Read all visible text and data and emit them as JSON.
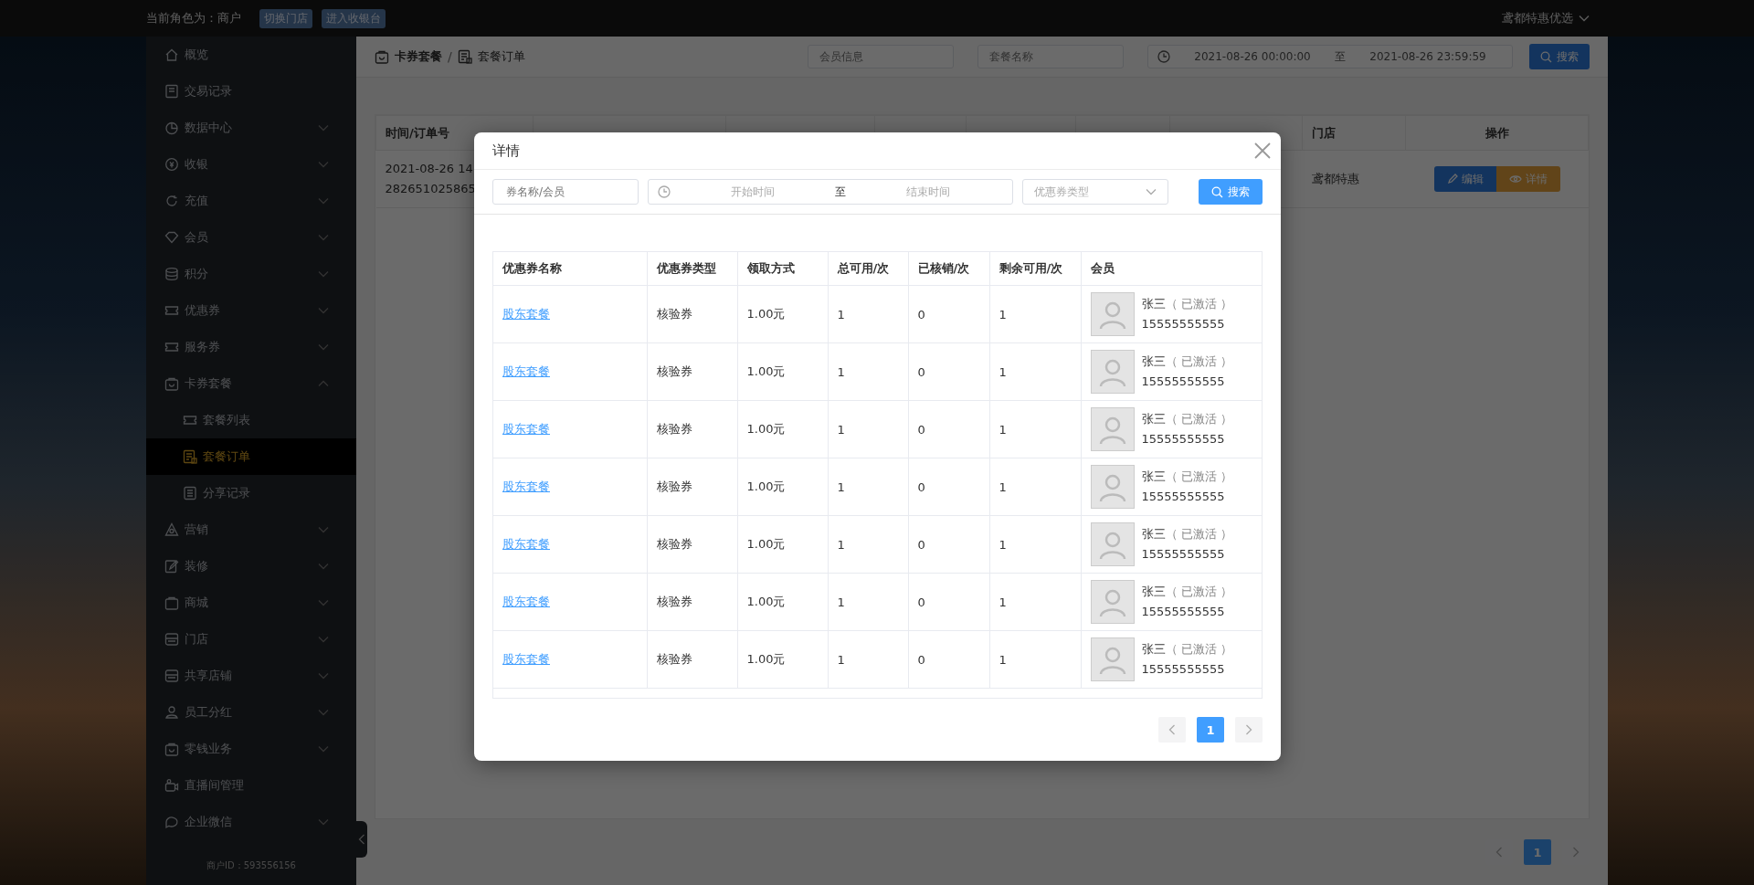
{
  "topbar": {
    "role_label": "当前角色为：商户",
    "buttons": [
      "切换门店",
      "进入收银台"
    ],
    "store_name": "鸢都特惠优选"
  },
  "sidebar": {
    "items": [
      {
        "label": "概览",
        "kind": "link",
        "selected": false
      },
      {
        "label": "交易记录",
        "kind": "link",
        "selected": false
      },
      {
        "label": "数据中心",
        "kind": "group",
        "expanded": false,
        "selected": false
      },
      {
        "label": "收银",
        "kind": "group",
        "expanded": false,
        "selected": false
      },
      {
        "label": "充值",
        "kind": "group",
        "expanded": false,
        "selected": false
      },
      {
        "label": "会员",
        "kind": "group",
        "expanded": false,
        "selected": false
      },
      {
        "label": "积分",
        "kind": "group",
        "expanded": false,
        "selected": false
      },
      {
        "label": "优惠券",
        "kind": "group",
        "expanded": false,
        "selected": false
      },
      {
        "label": "服务券",
        "kind": "group",
        "expanded": false,
        "selected": false
      },
      {
        "label": "卡券套餐",
        "kind": "group",
        "expanded": true,
        "selected": false,
        "children": [
          {
            "label": "套餐列表",
            "selected": false
          },
          {
            "label": "套餐订单",
            "selected": true
          },
          {
            "label": "分享记录",
            "selected": false
          }
        ]
      },
      {
        "label": "营销",
        "kind": "group",
        "expanded": false,
        "selected": false
      },
      {
        "label": "装修",
        "kind": "group",
        "expanded": false,
        "selected": false
      },
      {
        "label": "商城",
        "kind": "group",
        "expanded": false,
        "selected": false
      },
      {
        "label": "门店",
        "kind": "group",
        "expanded": false,
        "selected": false
      },
      {
        "label": "共享店铺",
        "kind": "group",
        "expanded": false,
        "selected": false
      },
      {
        "label": "员工分红",
        "kind": "group",
        "expanded": false,
        "selected": false
      },
      {
        "label": "零钱业务",
        "kind": "group",
        "expanded": false,
        "selected": false
      },
      {
        "label": "直播间管理",
        "kind": "link",
        "selected": false
      },
      {
        "label": "企业微信",
        "kind": "group",
        "expanded": false,
        "selected": false
      }
    ],
    "merchant_id": "商户ID：593556156"
  },
  "main": {
    "breadcrumb": [
      "卡券套餐",
      "套餐订单"
    ],
    "breadcrumb_separator": "/",
    "filters": {
      "member_placeholder": "会员信息",
      "package_placeholder": "套餐名称",
      "start_value": "2021-08-26 00:00:00",
      "separator": "至",
      "end_value": "2021-08-26 23:59:59",
      "search_button": "搜索"
    },
    "table": {
      "columns": [
        "时间/订单号",
        "门店",
        "操作"
      ],
      "rows": [
        {
          "time": "2021-08-26 14",
          "order_no": "282651025865",
          "store": "鸢都特惠",
          "actions": [
            "编辑",
            "详情"
          ]
        }
      ]
    },
    "pagination": {
      "pages": [
        {
          "label": "1",
          "selected": true
        }
      ]
    }
  },
  "modal": {
    "title": "详情",
    "filters": {
      "name_placeholder": "券名称/会员",
      "start_placeholder": "开始时间",
      "separator": "至",
      "end_placeholder": "结束时间",
      "type_placeholder": "优惠券类型",
      "search_button": "搜索"
    },
    "table": {
      "columns": [
        "优惠券名称",
        "优惠券类型",
        "领取方式",
        "总可用/次",
        "已核销/次",
        "剩余可用/次",
        "会员"
      ],
      "rows": [
        {
          "name": "股东套餐",
          "type": "核验券",
          "method": "1.00元",
          "total": "1",
          "used": "0",
          "remaining": "1",
          "member_name": "张三",
          "member_status": "（ 已激活 ）",
          "phone": "15555555555"
        },
        {
          "name": "股东套餐",
          "type": "核验券",
          "method": "1.00元",
          "total": "1",
          "used": "0",
          "remaining": "1",
          "member_name": "张三",
          "member_status": "（ 已激活 ）",
          "phone": "15555555555"
        },
        {
          "name": "股东套餐",
          "type": "核验券",
          "method": "1.00元",
          "total": "1",
          "used": "0",
          "remaining": "1",
          "member_name": "张三",
          "member_status": "（ 已激活 ）",
          "phone": "15555555555"
        },
        {
          "name": "股东套餐",
          "type": "核验券",
          "method": "1.00元",
          "total": "1",
          "used": "0",
          "remaining": "1",
          "member_name": "张三",
          "member_status": "（ 已激活 ）",
          "phone": "15555555555"
        },
        {
          "name": "股东套餐",
          "type": "核验券",
          "method": "1.00元",
          "total": "1",
          "used": "0",
          "remaining": "1",
          "member_name": "张三",
          "member_status": "（ 已激活 ）",
          "phone": "15555555555"
        },
        {
          "name": "股东套餐",
          "type": "核验券",
          "method": "1.00元",
          "total": "1",
          "used": "0",
          "remaining": "1",
          "member_name": "张三",
          "member_status": "（ 已激活 ）",
          "phone": "15555555555"
        },
        {
          "name": "股东套餐",
          "type": "核验券",
          "method": "1.00元",
          "total": "1",
          "used": "0",
          "remaining": "1",
          "member_name": "张三",
          "member_status": "（ 已激活 ）",
          "phone": "15555555555"
        }
      ]
    },
    "pagination": {
      "pages": [
        {
          "label": "1",
          "selected": true
        }
      ]
    }
  }
}
